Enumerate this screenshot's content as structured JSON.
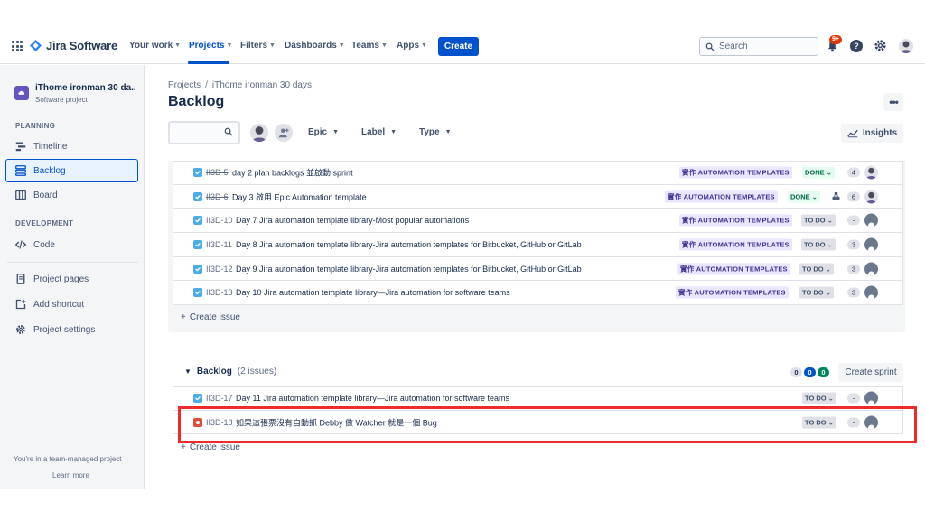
{
  "topnav": {
    "logo_text": "Jira Software",
    "items": [
      {
        "label": "Your work"
      },
      {
        "label": "Projects"
      },
      {
        "label": "Filters"
      },
      {
        "label": "Dashboards"
      },
      {
        "label": "Teams"
      },
      {
        "label": "Apps"
      }
    ],
    "create_label": "Create",
    "search_placeholder": "Search",
    "notifications_badge": "9+",
    "help_label": "?",
    "accent_color": "#0052cc"
  },
  "sidebar": {
    "project_name": "iThome ironman 30 da...",
    "project_type": "Software project",
    "planning_label": "PLANNING",
    "planning_items": [
      {
        "label": "Timeline",
        "icon": "timeline-icon"
      },
      {
        "label": "Backlog",
        "icon": "backlog-icon"
      },
      {
        "label": "Board",
        "icon": "board-icon"
      }
    ],
    "development_label": "DEVELOPMENT",
    "development_items": [
      {
        "label": "Code",
        "icon": "code-icon"
      }
    ],
    "other_items": [
      {
        "label": "Project pages",
        "icon": "page-icon"
      },
      {
        "label": "Add shortcut",
        "icon": "add-shortcut-icon"
      },
      {
        "label": "Project settings",
        "icon": "gear-icon"
      }
    ],
    "footer_text": "You're in a team-managed project",
    "footer_link": "Learn more"
  },
  "main": {
    "breadcrumb": [
      "Projects",
      "/",
      "iThome ironman 30 days"
    ],
    "title": "Backlog",
    "more_label": "•••",
    "filters": {
      "search_value": "",
      "dropdowns": [
        "Epic",
        "Label",
        "Type"
      ],
      "insights_label": "Insights"
    },
    "sprint_issues": [
      {
        "key": "II3D-5",
        "done": true,
        "summary": "day 2 plan backlogs 並啟動 sprint",
        "epic": "實作 AUTOMATION TEMPLATES",
        "status": "DONE",
        "status_type": "done",
        "points": "4",
        "assignee": true,
        "child": false
      },
      {
        "key": "II3D-6",
        "done": true,
        "summary": "Day 3 啟用 Epic Automation template",
        "epic": "實作 AUTOMATION TEMPLATES",
        "status": "DONE",
        "status_type": "done",
        "points": "6",
        "assignee": true,
        "child": true
      },
      {
        "key": "II3D-10",
        "done": false,
        "summary": "Day 7 Jira automation template library-Most popular automations",
        "epic": "實作 AUTOMATION TEMPLATES",
        "status": "TO DO",
        "status_type": "todo",
        "points": "-",
        "assignee": false,
        "child": false
      },
      {
        "key": "II3D-11",
        "done": false,
        "summary": "Day 8 Jira automation template library-Jira automation templates for Bitbucket, GitHub or GitLab",
        "epic": "實作 AUTOMATION TEMPLATES",
        "status": "TO DO",
        "status_type": "todo",
        "points": "3",
        "assignee": false,
        "child": false
      },
      {
        "key": "II3D-12",
        "done": false,
        "summary": "Day 9 Jira automation template library-Jira automation templates for Bitbucket, GitHub or GitLab",
        "epic": "實作 AUTOMATION TEMPLATES",
        "status": "TO DO",
        "status_type": "todo",
        "points": "3",
        "assignee": false,
        "child": false
      },
      {
        "key": "II3D-13",
        "done": false,
        "summary": "Day 10 Jira automation template library—Jira automation for software teams",
        "epic": "實作 AUTOMATION TEMPLATES",
        "status": "TO DO",
        "status_type": "todo",
        "points": "3",
        "assignee": false,
        "child": false
      }
    ],
    "create_issue_label": "Create issue",
    "backlog": {
      "title": "Backlog",
      "count": "(2 issues)",
      "counts": [
        {
          "value": "0",
          "bg": "#dfe1e6",
          "fg": "#172b4d"
        },
        {
          "value": "0",
          "bg": "#0052cc",
          "fg": "#ffffff"
        },
        {
          "value": "0",
          "bg": "#00875a",
          "fg": "#ffffff"
        }
      ],
      "create_sprint_label": "Create sprint",
      "issues": [
        {
          "key": "II3D-17",
          "type": "task",
          "summary": "Day 11 Jira automation template library—Jira automation for software teams",
          "status": "TO DO",
          "points": "-"
        },
        {
          "key": "II3D-18",
          "type": "bug",
          "summary": "如果這張票沒有自動抓 Debby 做 Watcher 就是一個 Bug",
          "status": "TO DO",
          "points": "-"
        }
      ]
    },
    "highlight_color": "#ee2a2a"
  }
}
